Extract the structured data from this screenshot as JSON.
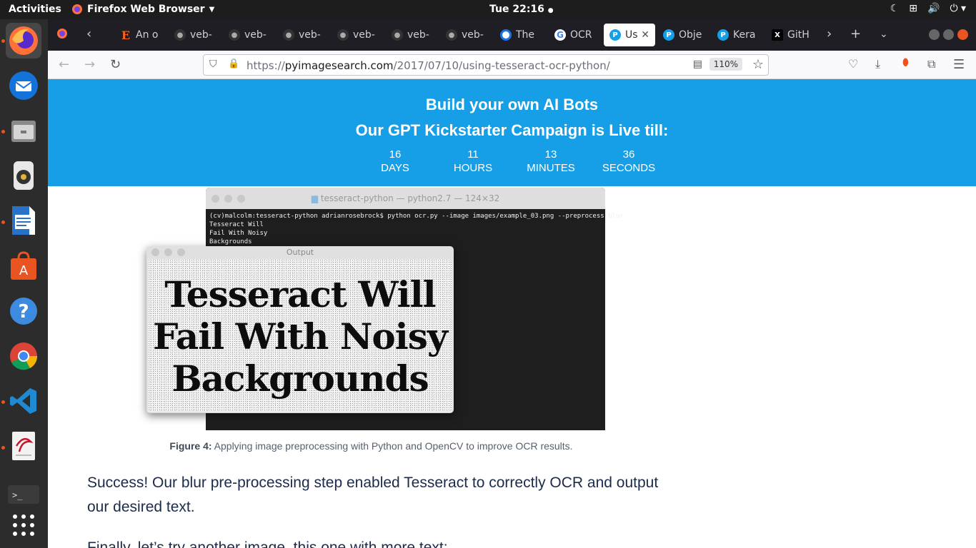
{
  "system": {
    "activities": "Activities",
    "app_name": "Firefox Web Browser",
    "clock": "Tue 22:16"
  },
  "browser": {
    "tabs": [
      {
        "label": "An o",
        "icon": "etsy-e"
      },
      {
        "label": "veb-",
        "icon": "github"
      },
      {
        "label": "veb-",
        "icon": "github"
      },
      {
        "label": "veb-",
        "icon": "github"
      },
      {
        "label": "veb-",
        "icon": "github"
      },
      {
        "label": "veb-",
        "icon": "github"
      },
      {
        "label": "veb-",
        "icon": "github"
      },
      {
        "label": "The ",
        "icon": "circle-logo"
      },
      {
        "label": "OCR",
        "icon": "google"
      },
      {
        "label": "Us",
        "icon": "pyimagesearch",
        "active": true
      },
      {
        "label": "Obje",
        "icon": "pyimagesearch"
      },
      {
        "label": "Kera",
        "icon": "pyimagesearch"
      },
      {
        "label": "GitH",
        "icon": "x-logo"
      }
    ],
    "url_prefix": "https://",
    "url_domain": "pyimagesearch.com",
    "url_path": "/2017/07/10/using-tesseract-ocr-python/",
    "zoom": "110%"
  },
  "banner": {
    "line1": "Build your own AI Bots",
    "line2": "Our GPT Kickstarter Campaign is Live till:",
    "countdown": [
      {
        "value": "16",
        "unit": "DAYS"
      },
      {
        "value": "11",
        "unit": "HOURS"
      },
      {
        "value": "13",
        "unit": "MINUTES"
      },
      {
        "value": "36",
        "unit": "SECONDS"
      }
    ]
  },
  "figure": {
    "terminal_title": "tesseract-python — python2.7 — 124×32",
    "terminal_lines": "(cv)malcolm:tesseract-python adrianrosebrock$ python ocr.py --image images/example_03.png --preprocess blur\nTesseract Will\nFail With Noisy\nBackgrounds",
    "output_title": "Output",
    "output_text_1": "Tesseract Will",
    "output_text_2": "Fail With Noisy",
    "output_text_3": "Backgrounds",
    "caption_label": "Figure 4:",
    "caption_text": " Applying image preprocessing with Python and OpenCV to improve OCR results."
  },
  "article": {
    "para1": "Success! Our blur pre-processing step enabled Tesseract to correctly OCR and output our desired text.",
    "para2": "Finally, let’s try another image, this one with more text:"
  }
}
